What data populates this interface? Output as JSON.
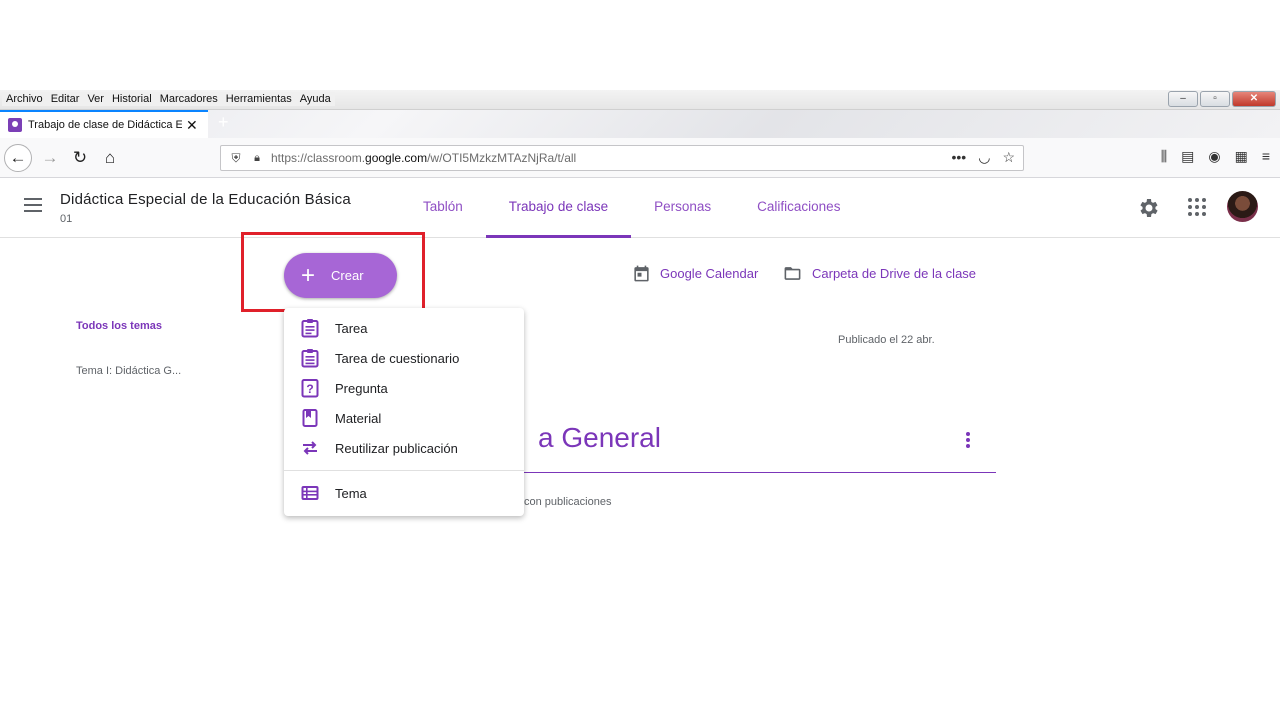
{
  "menubar": {
    "items": [
      "Archivo",
      "Editar",
      "Ver",
      "Historial",
      "Marcadores",
      "Herramientas",
      "Ayuda"
    ]
  },
  "window_controls": {
    "minimize": "–",
    "restore": "▫",
    "close": "✕"
  },
  "tab": {
    "title": "Trabajo de clase de Didáctica E",
    "close": "✕",
    "new_tab": "+"
  },
  "nav": {
    "url_prefix": "https://classroom.",
    "url_domain": "google.com",
    "url_suffix": "/w/OTI5MzkzMTAzNjRa/t/all"
  },
  "classroom": {
    "class_name": "Didáctica Especial de la Educación Básica",
    "section": "01",
    "tabs": [
      "Tablón",
      "Trabajo de clase",
      "Personas",
      "Calificaciones"
    ],
    "active_tab": "Trabajo de clase"
  },
  "toolbar": {
    "create_label": "Crear",
    "calendar_label": "Google Calendar",
    "drive_label": "Carpeta de Drive de la clase"
  },
  "sidebar": {
    "all_topics": "Todos los temas",
    "topic_item": "Tema I: Didáctica G..."
  },
  "main": {
    "published": "Publicado el 22 abr.",
    "topic_title": "a General",
    "no_posts": "con publicaciones"
  },
  "create_menu": {
    "items": [
      "Tarea",
      "Tarea de cuestionario",
      "Pregunta",
      "Material",
      "Reutilizar publicación"
    ],
    "topic_item": "Tema",
    "icons": [
      "assignment-icon",
      "quiz-assignment-icon",
      "question-icon",
      "material-icon",
      "reuse-post-icon",
      "topic-icon"
    ]
  },
  "colors": {
    "accent": "#7b36b9",
    "create_button": "#a766d6",
    "highlight_box": "#e0202a"
  }
}
